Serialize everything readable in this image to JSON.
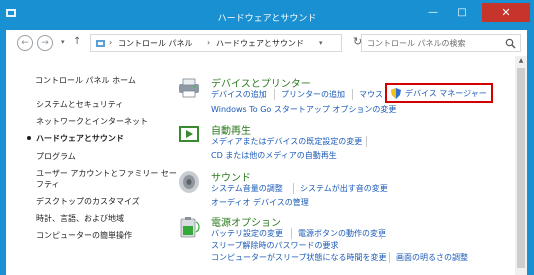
{
  "window": {
    "title": "ハードウェアとサウンド",
    "min_label": "—",
    "max_label": "□",
    "close_label": "✕"
  },
  "nav": {
    "back_label": "←",
    "forward_label": "→",
    "recent_label": "▾",
    "up_label": "↑",
    "breadcrumb": [
      "コントロール パネル",
      "ハードウェアとサウンド"
    ],
    "separator": "›",
    "dropdown_label": "▾",
    "refresh_label": "↻",
    "search_placeholder": "コントロール パネルの検索"
  },
  "sidebar": {
    "home": "コントロール パネル ホーム",
    "items": [
      "システムとセキュリティ",
      "ネットワークとインターネット",
      "ハードウェアとサウンド",
      "プログラム",
      "ユーザー アカウントとファミリー セー",
      "フティ",
      "デスクトップのカスタマイズ",
      "時計、言語、および地域",
      "コンピューターの簡単操作"
    ]
  },
  "categories": {
    "devices": {
      "title": "デバイスとプリンター",
      "icon": "printer-icon",
      "links": [
        "デバイスの追加",
        "プリンターの追加",
        "マウス",
        "デバイス マネージャー",
        "Windows To Go スタートアップ オプションの変更"
      ]
    },
    "autoplay": {
      "title": "自動再生",
      "icon": "autoplay-icon",
      "links": [
        "メディアまたはデバイスの既定設定の変更",
        "CD または他のメディアの自動再生"
      ]
    },
    "sound": {
      "title": "サウンド",
      "icon": "speaker-icon",
      "links": [
        "システム音量の調整",
        "システムが出す音の変更",
        "オーディオ デバイスの管理"
      ]
    },
    "power": {
      "title": "電源オプション",
      "icon": "battery-icon",
      "links": [
        "バッテリ設定の変更",
        "電源ボタンの動作の変更",
        "スリープ解除時のパスワードの要求",
        "コンピューターがスリープ状態になる時間を変更",
        "画面の明るさの調整"
      ]
    }
  },
  "colors": {
    "titlebar": "#1990d1",
    "close": "#c7342b",
    "category_title": "#2a7a1c",
    "link": "#1a5ab8",
    "highlight": "#d40000"
  }
}
